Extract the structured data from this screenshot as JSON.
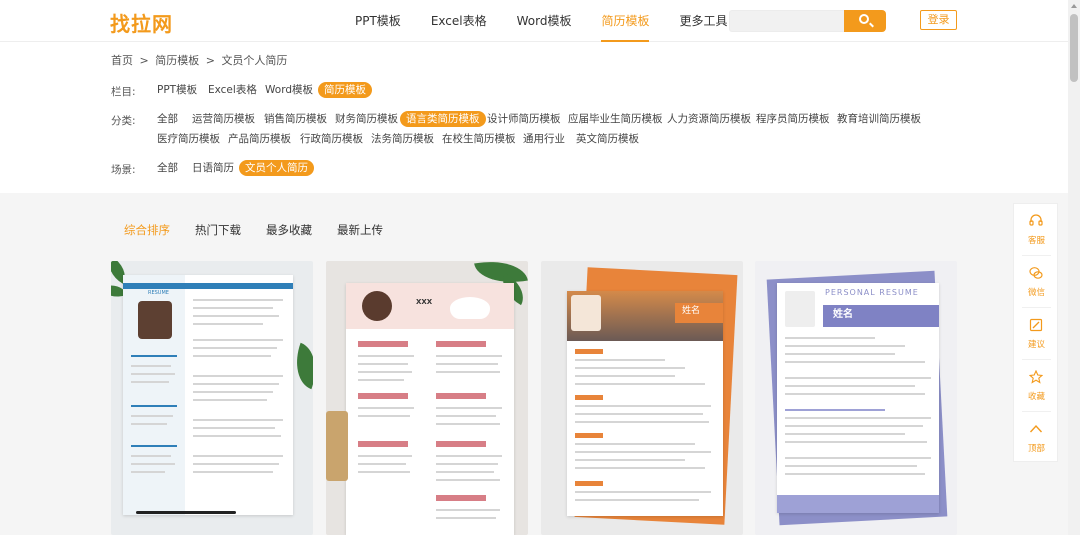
{
  "header": {
    "logo": "找拉网",
    "nav": [
      {
        "label": "PPT模板",
        "active": false
      },
      {
        "label": "Excel表格",
        "active": false
      },
      {
        "label": "Word模板",
        "active": false
      },
      {
        "label": "简历模板",
        "active": true
      },
      {
        "label": "更多工具",
        "active": false
      }
    ],
    "search_placeholder": "",
    "login_label": "登录"
  },
  "breadcrumb": [
    "首页",
    ">",
    "简历模板",
    ">",
    "文员个人简历"
  ],
  "filters": {
    "column": {
      "label": "栏目:",
      "items": [
        "PPT模板",
        "Excel表格",
        "Word模板",
        "简历模板"
      ],
      "active_index": 3
    },
    "category": {
      "label": "分类:",
      "items_row1": [
        "全部",
        "运营简历模板",
        "销售简历模板",
        "财务简历模板",
        "语言类简历模板",
        "设计师简历模板",
        "应届毕业生简历模板",
        "人力资源简历模板",
        "程序员简历模板",
        "教育培训简历模板"
      ],
      "items_row2": [
        "医疗简历模板",
        "产品简历模板",
        "行政简历模板",
        "法务简历模板",
        "在校生简历模板",
        "通用行业",
        "英文简历模板"
      ],
      "active_index": 4
    },
    "scene": {
      "label": "场景:",
      "items": [
        "全部",
        "日语简历",
        "文员个人简历"
      ],
      "active_index": 2
    }
  },
  "sort_tabs": [
    {
      "label": "综合排序",
      "active": true
    },
    {
      "label": "热门下载",
      "active": false
    },
    {
      "label": "最多收藏",
      "active": false
    },
    {
      "label": "最新上传",
      "active": false
    }
  ],
  "cards": [
    {
      "theme": "blue",
      "headline": "RESUME"
    },
    {
      "theme": "pink",
      "headline": "XXX"
    },
    {
      "theme": "orange",
      "headline": "姓名"
    },
    {
      "theme": "purple",
      "headline": "姓名",
      "subtitle": "PERSONAL   RESUME"
    }
  ],
  "side_tools": [
    {
      "label": "客服",
      "icon": "headset-icon"
    },
    {
      "label": "微信",
      "icon": "wechat-icon"
    },
    {
      "label": "建议",
      "icon": "feedback-icon"
    },
    {
      "label": "收藏",
      "icon": "star-icon"
    },
    {
      "label": "顶部",
      "icon": "back-to-top-icon"
    }
  ],
  "colors": {
    "accent": "#f39a1c",
    "bg_gray": "#f5f5f5"
  }
}
